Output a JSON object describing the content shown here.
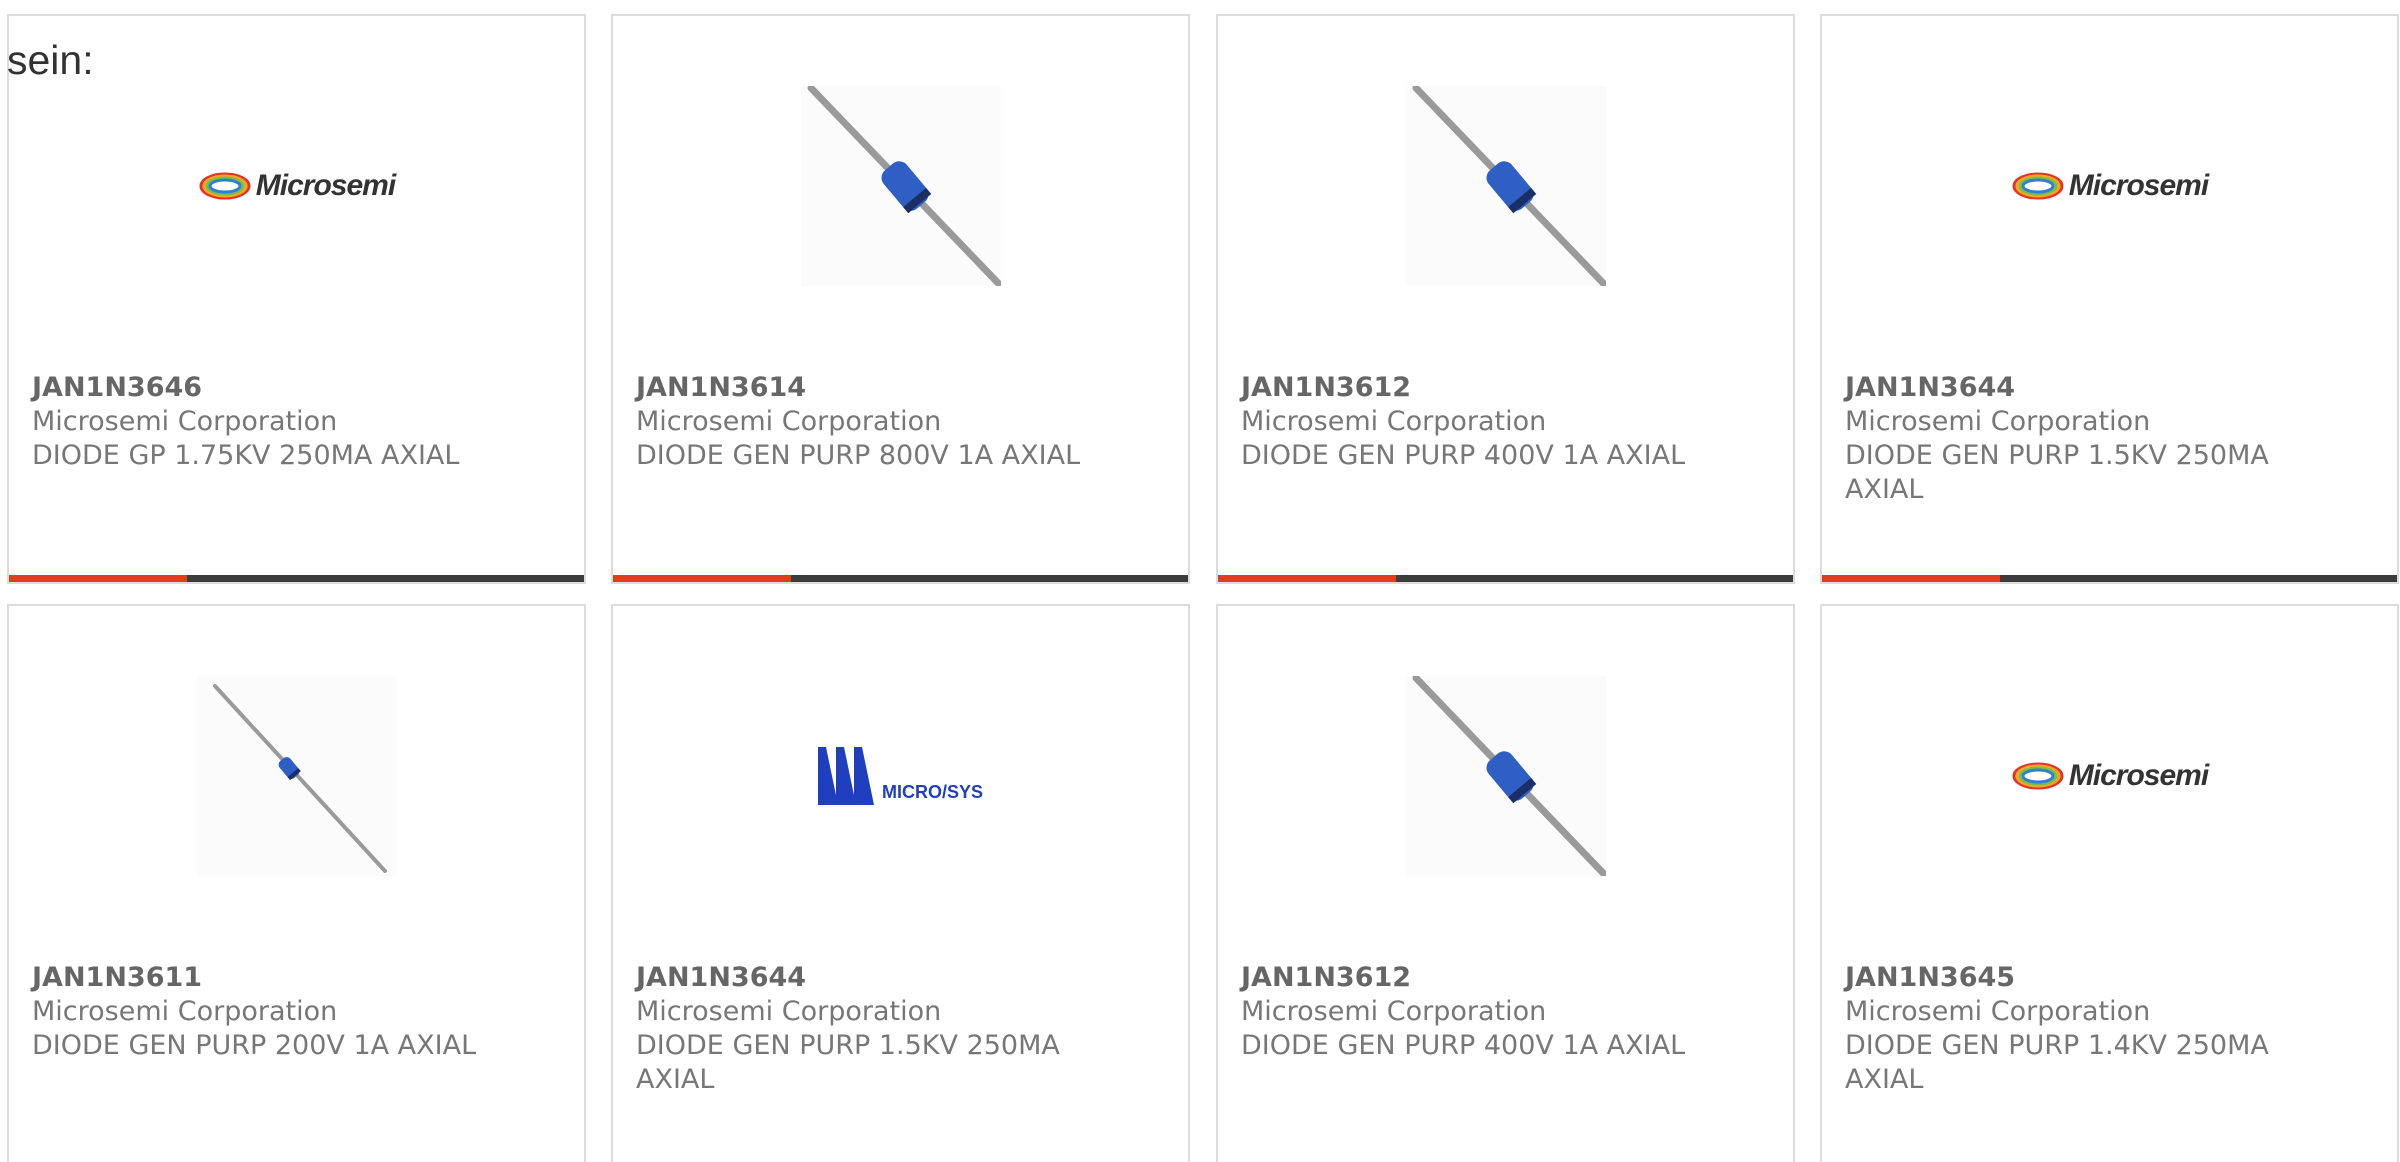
{
  "lead_text": "sein:",
  "cards": [
    {
      "part": "JAN1N3646",
      "mfr": "Microsemi Corporation",
      "desc": "DIODE GP 1.75KV 250MA AXIAL",
      "image": "microsemi-logo",
      "logo_text": "Microsemi"
    },
    {
      "part": "JAN1N3614",
      "mfr": "Microsemi Corporation",
      "desc": "DIODE GEN PURP 800V 1A AXIAL",
      "image": "axial-diode-photo"
    },
    {
      "part": "JAN1N3612",
      "mfr": "Microsemi Corporation",
      "desc": "DIODE GEN PURP 400V 1A AXIAL",
      "image": "axial-diode-photo"
    },
    {
      "part": "JAN1N3644",
      "mfr": "Microsemi Corporation",
      "desc": "DIODE GEN PURP 1.5KV 250MA AXIAL",
      "image": "microsemi-logo",
      "logo_text": "Microsemi"
    },
    {
      "part": "JAN1N3611",
      "mfr": "Microsemi Corporation",
      "desc": "DIODE GEN PURP 200V 1A AXIAL",
      "image": "axial-diode-photo-small"
    },
    {
      "part": "JAN1N3644",
      "mfr": "Microsemi Corporation",
      "desc": "DIODE GEN PURP 1.5KV 250MA AXIAL",
      "image": "microsys-logo",
      "logo_text": "MICRO/SYS"
    },
    {
      "part": "JAN1N3612",
      "mfr": "Microsemi Corporation",
      "desc": "DIODE GEN PURP 400V 1A AXIAL",
      "image": "axial-diode-photo"
    },
    {
      "part": "JAN1N3645",
      "mfr": "Microsemi Corporation",
      "desc": "DIODE GEN PURP 1.4KV 250MA AXIAL",
      "image": "microsemi-logo",
      "logo_text": "Microsemi"
    }
  ],
  "colors": {
    "accent": "#e33c1a",
    "bar": "#3c3c3c",
    "border": "#dcdcdc",
    "text": "#777777",
    "diode_blue": "#2f5fc4"
  },
  "accent_fraction": 0.31
}
